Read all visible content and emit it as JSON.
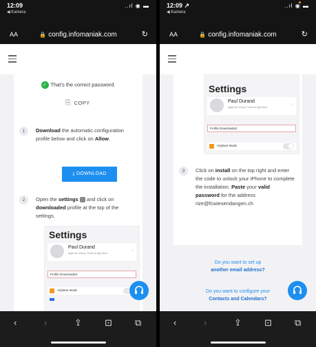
{
  "colors": {
    "accent": "#1d8ff0",
    "success": "#2bb24c",
    "statusbar": "#141414",
    "toolbar": "#1c1c1c"
  },
  "left": {
    "statusbar": {
      "time": "12:09",
      "back": "◀ Kamera",
      "icons": "..ıl ◉ ▬"
    },
    "address": {
      "aa": "AA",
      "url": "config.infomaniak.com",
      "reload_icon": "reload-icon"
    },
    "correct_password": "That's the correct password.",
    "copy_label": "COPY",
    "step1": {
      "num": "1",
      "bold1": "Download",
      "text1": " the automatic configuration profile below and click on ",
      "bold2": "Allow",
      "text2": "."
    },
    "download_label": "DOWNLOAD",
    "step2": {
      "num": "2",
      "text1": "Open the ",
      "bold1": "settings",
      "text2": " and click on ",
      "bold2": "downloaded",
      "text3": " profile at the top of the settings."
    },
    "settings_shot": {
      "title": "Settings",
      "name": "Paul Durand",
      "sub": "Apple ID, iCloud, iTunes & App Store",
      "profile_downloaded": "Profile Downloaded",
      "airplane": "Airplane Mode"
    }
  },
  "right": {
    "statusbar": {
      "time": "12:09 ↗",
      "back": "◀ Kamera",
      "icons": "..ıl ◉ ▬"
    },
    "address": {
      "aa": "AA",
      "url": "config.infomaniak.com"
    },
    "settings_shot": {
      "title": "Settings",
      "name": "Paul Durand",
      "sub": "Apple ID, iCloud, iTunes & App Store",
      "profile_downloaded": "Profile Downloaded",
      "airplane": "Airplane Mode"
    },
    "step3": {
      "num": "3",
      "text1": "Click on ",
      "bold1": "install",
      "text2": " on the top right and enter the code to unlock your iPhone to complete the installation. ",
      "bold2": "Paste",
      "text3": " your ",
      "bold3": "valid password",
      "text4": " for the address rize@fcwiesendangen.ch"
    },
    "link1": {
      "text": "Do you want to set up",
      "bold": "another email address?"
    },
    "link2": {
      "text": "Do you want to configure your",
      "bold": "Contacts and Calendars?"
    }
  },
  "toolbar": {
    "back": "‹",
    "forward": "›",
    "share": "⇪",
    "bookmarks": "⊡",
    "tabs": "⧉"
  }
}
